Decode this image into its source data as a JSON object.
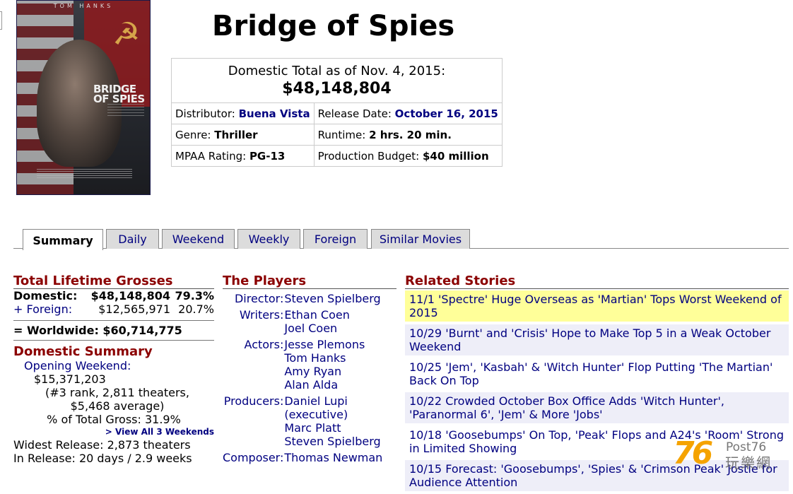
{
  "poster": {
    "actor": "TOM HANKS",
    "title_line1": "BRIDGE",
    "title_line2": "OF SPIES",
    "symbol": "☭"
  },
  "title": "Bridge of Spies",
  "totals": {
    "label": "Domestic Total as of Nov. 4, 2015:",
    "value": "$48,148,804"
  },
  "info": {
    "distributor_label": "Distributor:",
    "distributor": "Buena Vista",
    "release_label": "Release Date:",
    "release": "October 16, 2015",
    "genre_label": "Genre:",
    "genre": "Thriller",
    "runtime_label": "Runtime:",
    "runtime": "2 hrs. 20 min.",
    "rating_label": "MPAA Rating:",
    "rating": "PG-13",
    "budget_label": "Production Budget:",
    "budget": "$40 million"
  },
  "tabs": [
    "Summary",
    "Daily",
    "Weekend",
    "Weekly",
    "Foreign",
    "Similar Movies"
  ],
  "grosses": {
    "heading": "Total Lifetime Grosses",
    "domestic_label": "Domestic:",
    "domestic_value": "$48,148,804",
    "domestic_pct": "79.3%",
    "foreign_label": "+ Foreign:",
    "foreign_value": "$12,565,971",
    "foreign_pct": "20.7%",
    "worldwide": "= Worldwide: $60,714,775"
  },
  "domestic_summary": {
    "heading": "Domestic Summary",
    "opening_label": "Opening Weekend:",
    "opening_value": "$15,371,203",
    "opening_detail": "(#3 rank, 2,811 theaters, $5,468 average)",
    "pct_total": "% of Total Gross: 31.9%",
    "view_all": "> View All 3 Weekends",
    "widest": "Widest Release: 2,873 theaters",
    "in_release": "In Release: 20 days / 2.9 weeks"
  },
  "players": {
    "heading": "The Players",
    "director_label": "Director:",
    "director": [
      "Steven Spielberg"
    ],
    "writers_label": "Writers:",
    "writers": [
      "Ethan Coen",
      "Joel Coen"
    ],
    "actors_label": "Actors:",
    "actors": [
      "Jesse Plemons",
      "Tom Hanks",
      "Amy Ryan",
      "Alan Alda"
    ],
    "producers_label": "Producers:",
    "producers": [
      "Daniel Lupi",
      "(executive)",
      "Marc Platt",
      "Steven Spielberg"
    ],
    "composer_label": "Composer:",
    "composer": [
      "Thomas Newman"
    ]
  },
  "stories": {
    "heading": "Related Stories",
    "items": [
      "11/1 'Spectre' Huge Overseas as 'Martian' Tops Worst Weekend of 2015",
      "10/29 'Burnt' and 'Crisis' Hope to Make Top 5 in a Weak October Weekend",
      "10/25 'Jem', 'Kasbah' & 'Witch Hunter' Flop Putting 'The Martian' Back On Top",
      "10/22 Crowded October Box Office Adds 'Witch Hunter', 'Paranormal 6', 'Jem' & More 'Jobs'",
      "10/18 'Goosebumps' On Top, 'Peak' Flops and A24's 'Room' Strong in Limited Showing",
      "10/15 Forecast: 'Goosebumps', 'Spies' & 'Crimson Peak' Jostle for Audience Attention"
    ]
  },
  "watermark": {
    "num": "76",
    "brand": "Post76",
    "cjk": "玩樂網"
  },
  "colors": {
    "heading": "#8b0000",
    "link": "#000080",
    "highlight": "#ffff99",
    "stripe": "#eeeef8"
  }
}
